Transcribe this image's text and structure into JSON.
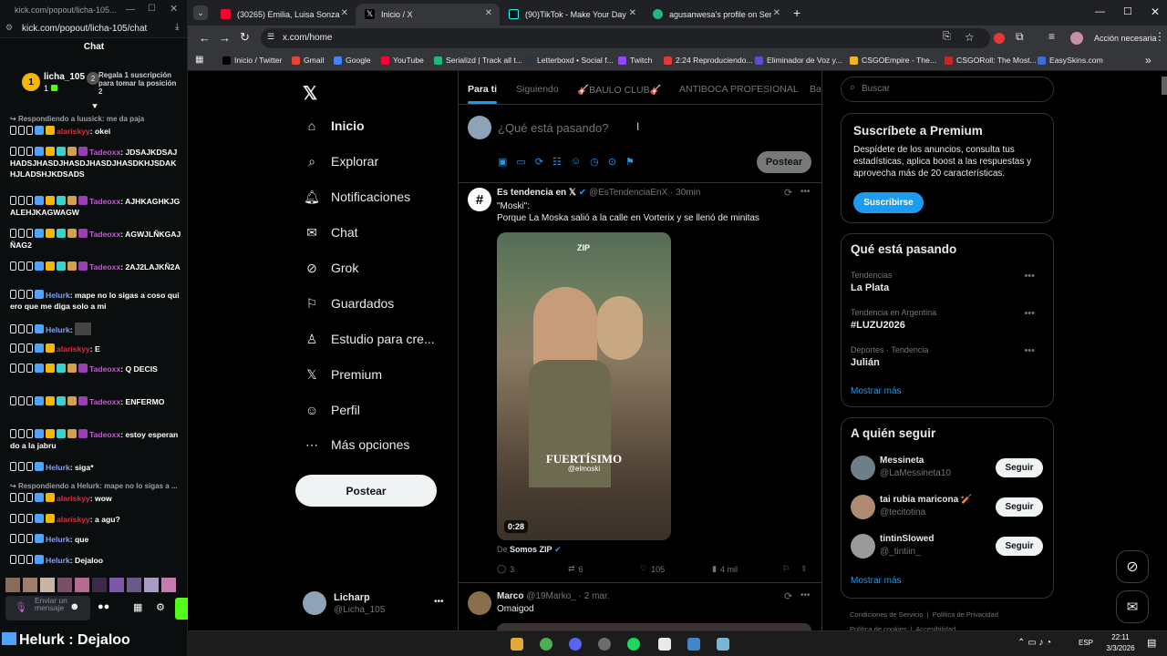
{
  "kick": {
    "window_url": "kick.com/popout/licha-105...",
    "url": "kick.com/popout/licha-105/chat",
    "chat_title": "Chat",
    "user": {
      "name": "licha_105",
      "count": "1"
    },
    "promo": "Regala 1 suscripción para tomar la posición 2",
    "reply1": "Respondiendo a luusick: me da paja",
    "reply2": "Respondiendo a Helurk: mape no lo sigas a ...",
    "messages": [
      {
        "user": "alariskyy",
        "color": "#e22b39",
        "text": "okei"
      },
      {
        "user": "Tadeoxx",
        "color": "#c45bd6",
        "text": "JDSAJKDSAJHADSJHASDJHASDJHASDJHASDKHJSDAKHJLADSHJKDSADS"
      },
      {
        "user": "Tadeoxx",
        "color": "#c45bd6",
        "text": "AJHKAGHKJGALEHJKAGWAGW"
      },
      {
        "user": "Tadeoxx",
        "color": "#c45bd6",
        "text": "AGWJLÑKGAJÑAG2"
      },
      {
        "user": "Tadeoxx",
        "color": "#c45bd6",
        "text": "2AJ2LAJKÑ2A"
      },
      {
        "user": "Helurk",
        "color": "#7fa0ff",
        "text": "mape no lo sigas a coso quiero que me diga solo a mi"
      },
      {
        "user": "Helurk",
        "color": "#7fa0ff",
        "text": ""
      },
      {
        "user": "alariskyy",
        "color": "#e22b39",
        "text": "E"
      },
      {
        "user": "Tadeoxx",
        "color": "#c45bd6",
        "text": "Q DECIS"
      },
      {
        "user": "Tadeoxx",
        "color": "#c45bd6",
        "text": "ENFERMO"
      },
      {
        "user": "Tadeoxx",
        "color": "#c45bd6",
        "text": "estoy esperando a la jabru"
      },
      {
        "user": "Helurk",
        "color": "#7fa0ff",
        "text": "siga*"
      },
      {
        "user": "alariskyy",
        "color": "#e22b39",
        "text": "wow"
      },
      {
        "user": "alariskyy",
        "color": "#e22b39",
        "text": "a agu?"
      },
      {
        "user": "Helurk",
        "color": "#7fa0ff",
        "text": "que"
      },
      {
        "user": "Helurk",
        "color": "#7fa0ff",
        "text": "Dejaloo"
      }
    ],
    "input_placeholder": "Enviar un mensaje",
    "overlay_user": "Helurk",
    "overlay_text": "Dejaloo"
  },
  "browser": {
    "tabs": [
      {
        "title": "(30265) Emilia, Luisa Sonza",
        "color": "#ff0033"
      },
      {
        "title": "Inicio / X",
        "color": "#000000"
      },
      {
        "title": "(90)TikTok - Make Your Day",
        "color": "#111111"
      },
      {
        "title": "agusanwesa's profile on Serializd",
        "color": "#1fb87a"
      }
    ],
    "url": "x.com/home",
    "action_button": "Acción necesaria",
    "bookmarks": [
      "Inicio / Twitter",
      "Gmail",
      "Google",
      "YouTube",
      "Serializd | Track all t...",
      "Letterboxd • Social f...",
      "Twitch",
      "2:24 Reproduciendo...",
      "Eliminador de Voz y...",
      "CSGOEmpire - The...",
      "CSGORoll: The Most...",
      "EasySkins.com"
    ]
  },
  "x": {
    "nav": [
      "Inicio",
      "Explorar",
      "Notificaciones",
      "Chat",
      "Grok",
      "Guardados",
      "Estudio para cre...",
      "Premium",
      "Perfil",
      "Más opciones"
    ],
    "post_button": "Postear",
    "account": {
      "name": "Licharp",
      "handle": "@Licha_105"
    },
    "tabs": [
      "Para ti",
      "Siguiendo",
      "🎸BAULO CLUB🎸",
      "ANTIBOCA PROFESIONAL",
      "Ba"
    ],
    "compose_placeholder": "¿Qué está pasando?",
    "compose_post": "Postear",
    "tweet1": {
      "name": "Es tendencia en 𝕏",
      "handle": "@EsTendenciaEnX",
      "time": "· 30min",
      "line1": "\"Moski\":",
      "line2": "Porque La Moska salió a la calle en Vorterix y se llenó de minitas",
      "video_time": "0:28",
      "video_caption": "FUERTÍSIMO",
      "video_tag": "@elmoski",
      "source_prefix": "De",
      "source": "Somos ZIP",
      "replies": "3",
      "reposts": "6",
      "likes": "105",
      "views": "4 mil"
    },
    "tweet2": {
      "name": "Marco",
      "handle": "@19Marko_",
      "time": "· 2 mar.",
      "text": "Omaigod"
    },
    "search_placeholder": "Buscar",
    "premium": {
      "title": "Suscríbete a Premium",
      "body": "Despídete de los anuncios, consulta tus estadísticas, aplica boost a las respuestas y aprovecha más de 20 características.",
      "button": "Suscribirse"
    },
    "trends_title": "Qué está pasando",
    "trends": [
      {
        "context": "Tendencias",
        "name": "La Plata"
      },
      {
        "context": "Tendencia en Argentina",
        "name": "#LUZU2026"
      },
      {
        "context": "Deportes · Tendencia",
        "name": "Julián"
      }
    ],
    "show_more": "Mostrar más",
    "follow_title": "A quién seguir",
    "follow": [
      {
        "name": "Messineta",
        "handle": "@LaMessineta10"
      },
      {
        "name": "tai rubia maricona 🏏",
        "handle": "@tecitotina"
      },
      {
        "name": "tintinSlowed",
        "handle": "@_tintiin_"
      }
    ],
    "follow_button": "Seguir",
    "footer1": [
      "Condiciones de Servicio",
      "Política de Privacidad"
    ],
    "footer2": [
      "Política de cookies",
      "Accesibilidad"
    ]
  },
  "taskbar": {
    "lang": "ESP",
    "time": "22:11",
    "date": "3/3/2026"
  }
}
